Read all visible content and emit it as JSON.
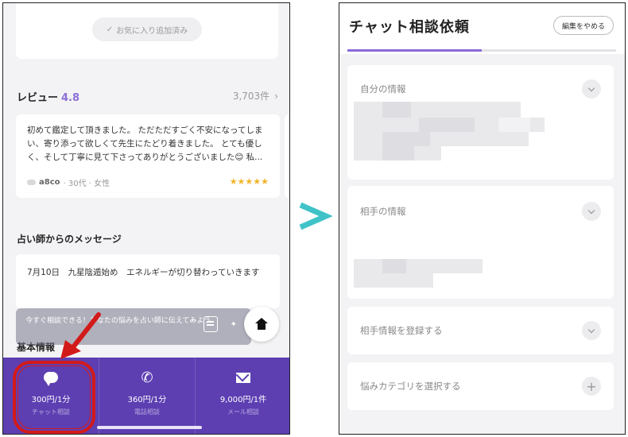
{
  "left": {
    "favorite_button": "お気に入り追加済み",
    "review": {
      "title": "レビュー",
      "score": "4.8",
      "count": "3,703件",
      "text": "初めて鑑定して頂きました。 ただただすごく不安になってしまい、寄り添って欲しくて先生にたどり着きました。 とても優しく、そして丁寧に見て下さってありがとうございました😊 私...",
      "user": "a8co",
      "meta": "· 30代 · 女性",
      "stars": "★★★★★",
      "rating": 5
    },
    "message": {
      "title": "占い師からのメッセージ",
      "text": "7月10日　九星陰遁始め　エネルギーが切り替わっていきます"
    },
    "basic_info_title": "基本情報",
    "toast": "今すぐ相談できる！あなたの悩みを占い師に伝えてみよう",
    "tabs": [
      {
        "icon": "chat-bubble-icon",
        "price": "300円/1分",
        "label": "チャット相談"
      },
      {
        "icon": "phone-icon",
        "price": "360円/1分",
        "label": "電話相談"
      },
      {
        "icon": "mail-icon",
        "price": "9,000円/1件",
        "label": "メール相談"
      }
    ]
  },
  "right": {
    "title": "チャット相談依頼",
    "edit_button": "編集をやめる",
    "progress": 0.5,
    "sections": {
      "self_info": "自分の情報",
      "partner_info": "相手の情報",
      "register_partner": "相手情報を登録する",
      "select_category": "悩みカテゴリを選択する"
    }
  },
  "colors": {
    "brand_purple": "#5d3fb2",
    "accent_purple": "#8b6ad8",
    "annotation_red": "#d21a1a",
    "chevron_teal": "#3fc3c8",
    "star_yellow": "#f2b62c"
  }
}
